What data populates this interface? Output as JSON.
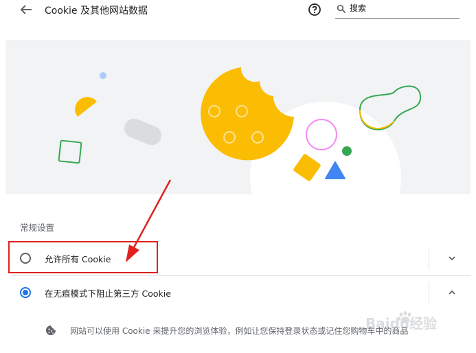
{
  "header": {
    "title": "Cookie 及其他网站数据",
    "back_icon": "arrow-left-icon",
    "help_icon": "help-circle-icon",
    "search": {
      "icon": "search-icon",
      "placeholder": "搜索"
    }
  },
  "hero": {
    "illustration": "cookie-illustration"
  },
  "general_settings": {
    "title": "常规设置",
    "options": [
      {
        "label": "允许所有 Cookie",
        "selected": false,
        "expanded": false
      },
      {
        "label": "在无痕模式下阻止第三方 Cookie",
        "selected": true,
        "expanded": true
      }
    ],
    "expanded_description": {
      "icon": "cookie-icon",
      "text": "网站可以使用 Cookie 来提升您的浏览体验，例如让您保持登录状态或记住您购物车中的商品"
    }
  },
  "annotation": {
    "color": "#e02020"
  },
  "watermark": {
    "text": "Baidu经验"
  },
  "colors": {
    "accent": "#1a73e8",
    "hero_background": "#f1f3f4",
    "cookie_yellow": "#fbbc04",
    "green": "#34a853",
    "blue": "#4285f4",
    "pink": "#f28bf3"
  }
}
